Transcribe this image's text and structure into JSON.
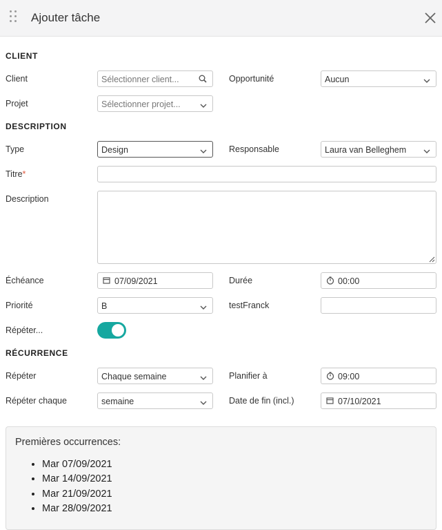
{
  "header": {
    "title": "Ajouter tâche"
  },
  "sections": {
    "client": "CLIENT",
    "description": "DESCRIPTION",
    "recurrence": "RÉCURRENCE"
  },
  "client": {
    "client_label": "Client",
    "client_placeholder": "Sélectionner client...",
    "opportunity_label": "Opportunité",
    "opportunity_value": "Aucun",
    "project_label": "Projet",
    "project_placeholder": "Sélectionner projet..."
  },
  "description": {
    "type_label": "Type",
    "type_value": "Design",
    "responsible_label": "Responsable",
    "responsible_value": "Laura van Belleghem",
    "title_label": "Titre",
    "title_required": "*",
    "title_value": "",
    "description_label": "Description",
    "description_value": "",
    "due_label": "Échéance",
    "due_value": "07/09/2021",
    "duration_label": "Durée",
    "duration_value": "00:00",
    "priority_label": "Priorité",
    "priority_value": "B",
    "custom_label": "testFranck",
    "custom_value": "",
    "repeat_label": "Répéter...",
    "repeat_on": true
  },
  "recurrence": {
    "repeat_label": "Répéter",
    "repeat_value": "Chaque semaine",
    "schedule_label": "Planifier à",
    "schedule_value": "09:00",
    "every_label": "Répéter chaque",
    "every_value": "semaine",
    "end_label": "Date de fin (incl.)",
    "end_value": "07/10/2021"
  },
  "occurrences": {
    "title": "Premières occurrences:",
    "items": [
      "Mar 07/09/2021",
      "Mar 14/09/2021",
      "Mar 21/09/2021",
      "Mar 28/09/2021"
    ]
  },
  "colors": {
    "toggle_on": "#16a8a0",
    "required": "#e05a3f"
  }
}
